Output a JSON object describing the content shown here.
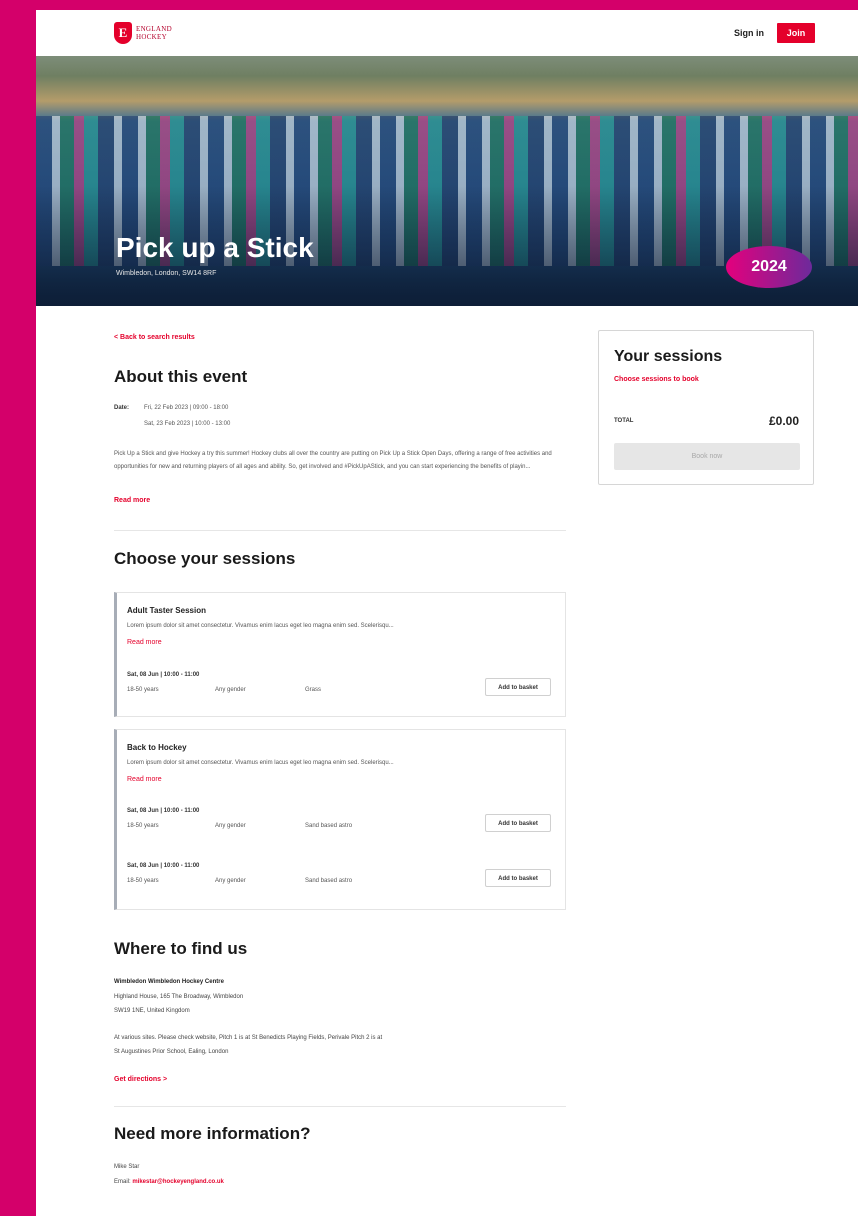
{
  "header": {
    "logo_letter": "E",
    "logo_line1": "ENGLAND",
    "logo_line2": "HOCKEY",
    "signin_label": "Sign in",
    "join_label": "Join"
  },
  "hero": {
    "title": "Pick up a Stick",
    "location": "Wimbledon, London, SW14 8RF",
    "badge_text": "2024"
  },
  "about": {
    "back_link": "< Back to search results",
    "heading": "About this event",
    "date_label": "Date:",
    "dates": [
      "Fri, 22 Feb 2023 | 09:00 - 18:00",
      "Sat, 23 Feb 2023 | 10:00 - 13:00"
    ],
    "description": "Pick Up a Stick and give Hockey a try this summer! Hockey clubs all over the country are putting on Pick Up a Stick Open Days, offering a range of free activities and opportunities for new and returning players of all ages and ability. So, get involved and #PickUpAStick, and you can start experiencing the benefits of playin...",
    "read_more": "Read more"
  },
  "sessions": {
    "heading": "Choose your sessions",
    "items": [
      {
        "title": "Adult Taster Session",
        "description": "Lorem ipsum dolor sit amet consectetur. Vivamus enim lacus eget leo magna enim sed. Scelerisqu...",
        "read_more": "Read more",
        "slots": [
          {
            "date": "Sat, 08 Jun  |  10:00 - 11:00",
            "age": "18-50 years",
            "gender": "Any gender",
            "price": "Grass",
            "button": "Add to basket"
          }
        ]
      },
      {
        "title": "Back to Hockey",
        "description": "Lorem ipsum dolor sit amet consectetur. Vivamus enim lacus eget leo magna enim sed. Scelerisqu...",
        "read_more": "Read more",
        "slots": [
          {
            "date": "Sat, 08 Jun  |  10:00 - 11:00",
            "age": "18-50 years",
            "gender": "Any gender",
            "price": "Sand based astro",
            "button": "Add to basket"
          },
          {
            "date": "Sat, 08 Jun  |  10:00 - 11:00",
            "age": "18-50 years",
            "gender": "Any gender",
            "price": "Sand based astro",
            "button": "Add to basket"
          }
        ]
      }
    ]
  },
  "location": {
    "heading": "Where to find us",
    "venue_name": "Wimbledon Wimbledon Hockey Centre",
    "address_line1": "Highland House, 165 The Broadway, Wimbledon",
    "address_line2": "SW19 1NE, United Kingdom",
    "note_line1": "At various sites. Please check website, Pitch 1 is at St Benedicts Playing Fields, Perivale Pitch 2 is at",
    "note_line2": "St Augustines Prior School, Ealing, London",
    "directions": "Get directions >"
  },
  "contact": {
    "heading": "Need more information?",
    "name": "Mike Star",
    "email_label": "Email:",
    "email": "mikestar@hockeyengland.co.uk"
  },
  "sidebar": {
    "title": "Your sessions",
    "subtitle": "Choose sessions to book",
    "total_label": "TOTAL",
    "total_value": "£0.00",
    "book_label": "Book now"
  },
  "colors": {
    "accent": "#e4002b",
    "frame": "#d4006a",
    "card_border": "#a7adb7"
  }
}
